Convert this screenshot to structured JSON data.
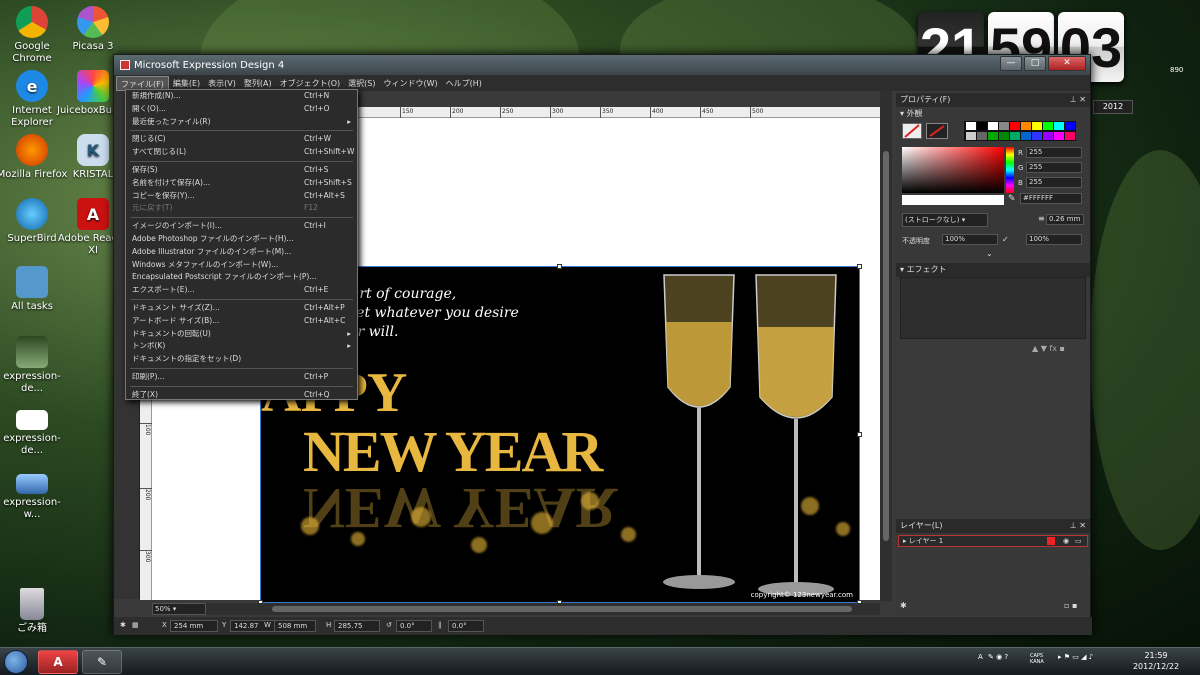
{
  "desktop": {
    "icons": [
      {
        "label": "Google Chrome"
      },
      {
        "label": "Picasa 3"
      },
      {
        "label": "Internet Explorer"
      },
      {
        "label": "JuiceboxBuilder"
      },
      {
        "label": "Mozilla Firefox"
      },
      {
        "label": "KRISTAL"
      },
      {
        "label": "SuperBird"
      },
      {
        "label": "Adobe Reader XI"
      },
      {
        "label": "All tasks"
      },
      {
        "label": "expression-de..."
      },
      {
        "label": "expression-de..."
      },
      {
        "label": "expression-w..."
      },
      {
        "label": "ごみ箱"
      }
    ],
    "clock_widget": {
      "hour": "21",
      "minute": "59",
      "second": "03",
      "side_text": "890",
      "year_badge": "2012"
    }
  },
  "window": {
    "title": "Microsoft Expression Design 4",
    "buttons": {
      "minimize": "—",
      "maximize": "□",
      "close": "✕"
    }
  },
  "menubar": [
    {
      "label": "ファイル(F)"
    },
    {
      "label": "編集(E)"
    },
    {
      "label": "表示(V)"
    },
    {
      "label": "整列(A)"
    },
    {
      "label": "オブジェクト(O)"
    },
    {
      "label": "選択(S)"
    },
    {
      "label": "ウィンドウ(W)"
    },
    {
      "label": "ヘルプ(H)"
    }
  ],
  "file_menu": [
    {
      "label": "新規作成(N)...",
      "shortcut": "Ctrl+N"
    },
    {
      "label": "開く(O)...",
      "shortcut": "Ctrl+O"
    },
    {
      "label": "最近使ったファイル(R)",
      "shortcut": "",
      "submenu": "▸"
    },
    {
      "sep": true
    },
    {
      "label": "閉じる(C)",
      "shortcut": "Ctrl+W"
    },
    {
      "label": "すべて閉じる(L)",
      "shortcut": "Ctrl+Shift+W"
    },
    {
      "sep": true
    },
    {
      "label": "保存(S)",
      "shortcut": "Ctrl+S"
    },
    {
      "label": "名前を付けて保存(A)...",
      "shortcut": "Ctrl+Shift+S"
    },
    {
      "label": "コピーを保存(Y)...",
      "shortcut": "Ctrl+Alt+S"
    },
    {
      "label": "元に戻す(T)",
      "shortcut": "F12",
      "disabled": true
    },
    {
      "sep": true
    },
    {
      "label": "イメージのインポート(I)...",
      "shortcut": "Ctrl+I"
    },
    {
      "label": "Adobe Photoshop ファイルのインポート(H)...",
      "shortcut": ""
    },
    {
      "label": "Adobe Illustrator ファイルのインポート(M)...",
      "shortcut": ""
    },
    {
      "label": "Windows メタファイルのインポート(W)...",
      "shortcut": ""
    },
    {
      "label": "Encapsulated Postscript ファイルのインポート(P)...",
      "shortcut": ""
    },
    {
      "label": "エクスポート(E)...",
      "shortcut": "Ctrl+E"
    },
    {
      "sep": true
    },
    {
      "label": "ドキュメント サイズ(Z)...",
      "shortcut": "Ctrl+Alt+P"
    },
    {
      "label": "アートボード サイズ(B)...",
      "shortcut": "Ctrl+Alt+C"
    },
    {
      "label": "ドキュメントの回転(U)",
      "shortcut": "",
      "submenu": "▸"
    },
    {
      "label": "トンボ(K)",
      "shortcut": "",
      "submenu": "▸"
    },
    {
      "label": "ドキュメントの指定をセット(D)",
      "shortcut": ""
    },
    {
      "sep": true
    },
    {
      "label": "印刷(P)...",
      "shortcut": "Ctrl+P"
    },
    {
      "sep": true
    },
    {
      "label": "終了(X)",
      "shortcut": "Ctrl+Q"
    }
  ],
  "rulers": {
    "top": [
      "150",
      "200",
      "250",
      "300",
      "350",
      "400",
      "450",
      "500"
    ],
    "left": [
      "100",
      "200",
      "300"
    ]
  },
  "artwork": {
    "poem": [
      "ou have a heart of courage,",
      "nd may you get whatever you desire",
      "always at your will."
    ],
    "happy": "APPY",
    "new_year": "NEW YEAR",
    "copyright": "copyright© 123newyear.com"
  },
  "properties_panel": {
    "title": "プロパティ(F)",
    "section": "外観",
    "rgb": {
      "r_label": "R",
      "r": "255",
      "g_label": "G",
      "g": "255",
      "b_label": "B",
      "b": "255"
    },
    "hex": "#FFFFFF",
    "stroke_select": "(ストロークなし)",
    "stroke_width": "0.26 mm",
    "opacity_label": "不透明度",
    "opacity": "100%",
    "opacity2": "100%",
    "colors": {
      "red": "#ff0000",
      "green": "#00aa00",
      "blue": "#0000ff"
    }
  },
  "effects_panel": {
    "title": "エフェクト",
    "fx": "fx"
  },
  "layers_panel": {
    "title": "レイヤー(L)",
    "layer_name": "レイヤー 1"
  },
  "statusbar": {
    "zoom": "50%",
    "x_label": "X",
    "x": "254 mm",
    "y_label": "Y",
    "y": "142.87",
    "w_label": "W",
    "w": "508 mm",
    "h_label": "H",
    "h": "285.75",
    "rotate": "0.0°",
    "skew": "0.0°"
  },
  "taskbar": {
    "tray_lang": "A",
    "caps": "CAPS KANA",
    "time": "21:59",
    "date": "2012/12/22"
  }
}
